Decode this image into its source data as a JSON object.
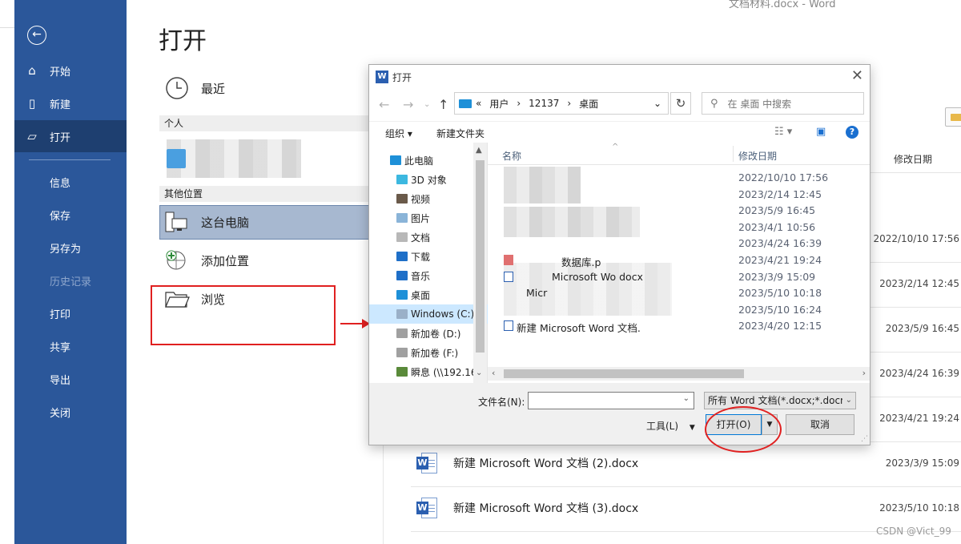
{
  "window": {
    "title": "文档材料.docx  -  Word"
  },
  "sidebar": {
    "items": [
      {
        "label": "开始",
        "icon": "home-icon"
      },
      {
        "label": "新建",
        "icon": "new-doc-icon"
      },
      {
        "label": "打开",
        "icon": "folder-open-icon",
        "active": true
      }
    ],
    "sub_items": [
      "信息",
      "保存",
      "另存为",
      "历史记录",
      "打印",
      "共享",
      "导出",
      "关闭"
    ]
  },
  "open_pane": {
    "title": "打开",
    "recent_label": "最近",
    "personal_header": "个人",
    "other_locations_header": "其他位置",
    "this_pc_label": "这台电脑",
    "add_place_label": "添加位置",
    "browse_label": "浏览"
  },
  "recent_files": {
    "header_date": "修改日期",
    "dates": [
      "2022/10/10 17:56",
      "2023/2/14 12:45",
      "2023/5/9 16:45",
      "2023/4/24 16:39",
      "2023/4/21 19:24",
      "2023/3/9 15:09",
      "2023/5/10 10:18"
    ],
    "visible_files": [
      {
        "name": "新建 Microsoft Word 文档 (2).docx",
        "date": "2023/3/9 15:09"
      },
      {
        "name": "新建 Microsoft Word 文档 (3).docx",
        "date": "2023/5/10 10:18"
      }
    ]
  },
  "dialog": {
    "title": "打开",
    "path": [
      "用户",
      "12137",
      "桌面"
    ],
    "path_prefix": "«",
    "search_placeholder": "在 桌面 中搜索",
    "organize_label": "组织 ▾",
    "new_folder_label": "新建文件夹",
    "tree": [
      {
        "label": "此电脑",
        "icon": "pc-icon"
      },
      {
        "label": "3D 对象",
        "icon": "3d-objects-icon"
      },
      {
        "label": "视频",
        "icon": "video-icon"
      },
      {
        "label": "图片",
        "icon": "pictures-icon"
      },
      {
        "label": "文档",
        "icon": "documents-icon"
      },
      {
        "label": "下载",
        "icon": "download-icon"
      },
      {
        "label": "音乐",
        "icon": "music-icon"
      },
      {
        "label": "桌面",
        "icon": "desktop-icon"
      },
      {
        "label": "Windows (C:)",
        "icon": "drive-icon",
        "selected": true
      },
      {
        "label": "新加卷 (D:)",
        "icon": "drive-icon"
      },
      {
        "label": "新加卷 (F:)",
        "icon": "drive-icon"
      },
      {
        "label": "瞬息 (\\\\192.16",
        "icon": "network-drive-icon"
      }
    ],
    "columns": {
      "name": "名称",
      "date": "修改日期"
    },
    "files": [
      {
        "name": "",
        "date": "2022/10/10 17:56"
      },
      {
        "name": "",
        "date": "2023/2/14 12:45"
      },
      {
        "name": "",
        "date": "2023/5/9 16:45"
      },
      {
        "name": "",
        "date": "2023/4/1 10:56"
      },
      {
        "name": "",
        "date": "2023/4/24 16:39"
      },
      {
        "name": "数据库.p",
        "date": "2023/4/21 19:24"
      },
      {
        "name": "Microsoft Wo              docx",
        "date": "2023/3/9 15:09"
      },
      {
        "name": "Micr",
        "date": "2023/5/10 10:18"
      },
      {
        "name": "",
        "date": "2023/5/10 16:24"
      },
      {
        "name": "新建 Microsoft Word 文档.",
        "date": "2023/4/20 12:15"
      }
    ],
    "filename_label": "文件名(N):",
    "filename_value": "",
    "filter_value": "所有 Word 文档(*.docx;*.docm",
    "tools_label": "工具(L)",
    "open_button": "打开(O)",
    "cancel_button": "取消"
  },
  "watermark": "CSDN @Vict_99"
}
